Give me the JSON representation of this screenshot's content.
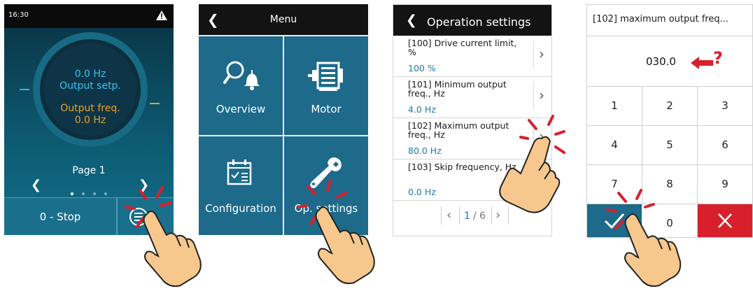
{
  "screen1": {
    "time": "16:30",
    "warning_icon": "warning-triangle-icon",
    "setpoint_value": "0.0 Hz",
    "setpoint_label": "Output setp.",
    "output_label": "Output freq.",
    "output_value": "0.0 Hz",
    "page_label": "Page 1",
    "stop_button": "0 - Stop",
    "menu_icon": "menu-list-icon",
    "colors": {
      "setpoint": "#3bc1ee",
      "output": "#f0a020"
    }
  },
  "screen2": {
    "title": "Menu",
    "tiles": [
      {
        "label": "Overview",
        "icon": "search-bell-icon"
      },
      {
        "label": "Motor",
        "icon": "motor-icon"
      },
      {
        "label": "Configuration",
        "icon": "calendar-check-icon"
      },
      {
        "label": "Op. settings",
        "icon": "wrench-icon"
      }
    ]
  },
  "screen3": {
    "title": "Operation settings",
    "rows": [
      {
        "name": "[100] Drive current limit, %",
        "value": "100 %"
      },
      {
        "name": "[101] Minimum output freq., Hz",
        "value": "4.0 Hz"
      },
      {
        "name": "[102] Maximum output freq., Hz",
        "value": "80.0 Hz"
      },
      {
        "name": "[103] Skip frequency, Hz",
        "value": "0.0 Hz"
      }
    ],
    "pager_current": "1",
    "pager_total": "/ 6"
  },
  "screen4": {
    "title": "[102] maximum output freq...",
    "value": "030.0",
    "keys": [
      "1",
      "2",
      "3",
      "4",
      "5",
      "6",
      "7",
      "8",
      "9",
      "0"
    ],
    "question_mark": "?",
    "accent_colors": {
      "ok": "#1d6a8a",
      "cancel": "#d8202c",
      "annotation": "#d8202c"
    }
  }
}
